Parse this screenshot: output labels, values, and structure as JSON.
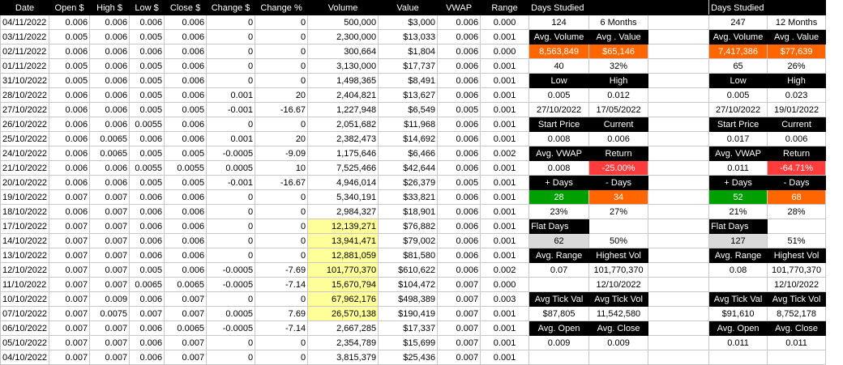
{
  "headers": [
    "Date",
    "Open $",
    "High $",
    "Low $",
    "Close $",
    "Change $",
    "Change %",
    "Volume",
    "Value",
    "VWAP",
    "Range"
  ],
  "rows": [
    [
      "04/11/2022",
      "0.006",
      "0.006",
      "0.006",
      "0.006",
      "0",
      "0",
      "500,000",
      "$3,000",
      "0.006",
      "0.000"
    ],
    [
      "03/11/2022",
      "0.005",
      "0.006",
      "0.005",
      "0.006",
      "0",
      "0",
      "2,300,000",
      "$13,033",
      "0.006",
      "0.001"
    ],
    [
      "02/11/2022",
      "0.006",
      "0.006",
      "0.006",
      "0.006",
      "0",
      "0",
      "300,664",
      "$1,804",
      "0.006",
      "0.000"
    ],
    [
      "01/11/2022",
      "0.005",
      "0.006",
      "0.005",
      "0.006",
      "0",
      "0",
      "3,130,000",
      "$17,737",
      "0.006",
      "0.001"
    ],
    [
      "31/10/2022",
      "0.005",
      "0.006",
      "0.005",
      "0.006",
      "0",
      "0",
      "1,498,365",
      "$8,491",
      "0.006",
      "0.001"
    ],
    [
      "28/10/2022",
      "0.006",
      "0.006",
      "0.005",
      "0.006",
      "0.001",
      "20",
      "2,404,821",
      "$13,627",
      "0.006",
      "0.001"
    ],
    [
      "27/10/2022",
      "0.006",
      "0.006",
      "0.005",
      "0.005",
      "-0.001",
      "-16.67",
      "1,227,948",
      "$6,549",
      "0.005",
      "0.001"
    ],
    [
      "26/10/2022",
      "0.006",
      "0.006",
      "0.0055",
      "0.006",
      "0",
      "0",
      "2,051,682",
      "$11,968",
      "0.006",
      "0.001"
    ],
    [
      "25/10/2022",
      "0.006",
      "0.0065",
      "0.006",
      "0.006",
      "0.001",
      "20",
      "2,382,473",
      "$14,692",
      "0.006",
      "0.001"
    ],
    [
      "24/10/2022",
      "0.006",
      "0.0065",
      "0.005",
      "0.005",
      "-0.0005",
      "-9.09",
      "1,175,646",
      "$6,466",
      "0.006",
      "0.002"
    ],
    [
      "21/10/2022",
      "0.006",
      "0.006",
      "0.0055",
      "0.0055",
      "0.0005",
      "10",
      "7,525,466",
      "$42,644",
      "0.006",
      "0.001"
    ],
    [
      "20/10/2022",
      "0.006",
      "0.006",
      "0.005",
      "0.005",
      "-0.001",
      "-16.67",
      "4,946,014",
      "$26,379",
      "0.005",
      "0.001"
    ],
    [
      "19/10/2022",
      "0.007",
      "0.007",
      "0.006",
      "0.006",
      "0",
      "0",
      "5,340,191",
      "$33,821",
      "0.006",
      "0.001"
    ],
    [
      "18/10/2022",
      "0.006",
      "0.007",
      "0.006",
      "0.006",
      "0",
      "0",
      "2,984,327",
      "$18,901",
      "0.006",
      "0.001"
    ],
    [
      "17/10/2022",
      "0.007",
      "0.007",
      "0.006",
      "0.006",
      "0",
      "0",
      "12,139,271",
      "$76,882",
      "0.006",
      "0.001"
    ],
    [
      "14/10/2022",
      "0.007",
      "0.007",
      "0.006",
      "0.006",
      "0",
      "0",
      "13,941,471",
      "$79,002",
      "0.006",
      "0.001"
    ],
    [
      "13/10/2022",
      "0.007",
      "0.007",
      "0.006",
      "0.006",
      "0",
      "0",
      "12,881,059",
      "$81,580",
      "0.006",
      "0.001"
    ],
    [
      "12/10/2022",
      "0.007",
      "0.007",
      "0.005",
      "0.006",
      "-0.0005",
      "-7.69",
      "101,770,370",
      "$610,622",
      "0.006",
      "0.002"
    ],
    [
      "11/10/2022",
      "0.007",
      "0.007",
      "0.0065",
      "0.0065",
      "-0.0005",
      "-7.14",
      "15,670,794",
      "$104,472",
      "0.007",
      "0.000"
    ],
    [
      "10/10/2022",
      "0.007",
      "0.009",
      "0.006",
      "0.007",
      "0",
      "0",
      "67,962,176",
      "$498,389",
      "0.007",
      "0.003"
    ],
    [
      "07/10/2022",
      "0.007",
      "0.0075",
      "0.007",
      "0.007",
      "0.0005",
      "7.69",
      "26,570,138",
      "$190,419",
      "0.007",
      "0.001"
    ],
    [
      "06/10/2022",
      "0.007",
      "0.007",
      "0.006",
      "0.0065",
      "-0.0005",
      "-7.14",
      "2,667,285",
      "$17,337",
      "0.007",
      "0.001"
    ],
    [
      "05/10/2022",
      "0.007",
      "0.007",
      "0.006",
      "0.007",
      "0",
      "0",
      "2,354,789",
      "$15,699",
      "0.007",
      "0.001"
    ],
    [
      "04/10/2022",
      "0.007",
      "0.007",
      "0.006",
      "0.007",
      "0",
      "0",
      "3,815,379",
      "$25,436",
      "0.007",
      "0.001"
    ]
  ],
  "highlighted_volume_rows": [
    14,
    15,
    16,
    17,
    18,
    19,
    20
  ],
  "colors": {
    "header_bg": "#000000",
    "highlight": "#ffff99",
    "orange": "#ff6600",
    "green": "#00a000",
    "red": "#ff3b3b",
    "grey": "#d9d9d9"
  },
  "panels": [
    {
      "days_label": "Days Studied",
      "days": "124",
      "period": "6 Months",
      "avg_volume_label": "Avg. Volume",
      "avg_value_label": "Avg . Value",
      "avg_volume": "8,563,849",
      "avg_value": "$65,146",
      "count_a": "40",
      "pct_a": "32%",
      "low_label": "Low",
      "high_label": "High",
      "low": "0.005",
      "high": "0.012",
      "low_date": "27/10/2022",
      "high_date": "17/05/2022",
      "start_label": "Start Price",
      "current_label": "Current",
      "start": "0.008",
      "current": "0.006",
      "vwap_label": "Avg. VWAP",
      "return_label": "Return",
      "vwap": "0.008",
      "return": "-25.00%",
      "plus_days_label": "+ Days",
      "minus_days_label": "- Days",
      "plus_days": "28",
      "minus_days": "34",
      "plus_pct": "23%",
      "minus_pct": "27%",
      "flat_label": "Flat Days",
      "flat": "62",
      "flat_pct": "50%",
      "range_label": "Avg. Range",
      "highest_vol_label": "Highest Vol",
      "range": "0.07",
      "highest_vol": "101,770,370",
      "highest_vol_date": "12/10/2022",
      "tick_val_label": "Avg Tick Val",
      "tick_vol_label": "Avg Tick Vol",
      "tick_val": "$87,805",
      "tick_vol": "11,542,580",
      "open_label": "Avg. Open",
      "close_label": "Avg. Close",
      "avg_open": "0.009",
      "avg_close": "0.009"
    },
    {
      "days_label": "Days Studied",
      "days": "247",
      "period": "12 Months",
      "avg_volume_label": "Avg. Volume",
      "avg_value_label": "Avg . Value",
      "avg_volume": "7,417,386",
      "avg_value": "$77,639",
      "count_a": "65",
      "pct_a": "26%",
      "low_label": "Low",
      "high_label": "High",
      "low": "0.005",
      "high": "0.023",
      "low_date": "27/10/2022",
      "high_date": "19/01/2022",
      "start_label": "Start Price",
      "current_label": "Current",
      "start": "0.017",
      "current": "0.006",
      "vwap_label": "Avg. VWAP",
      "return_label": "Return",
      "vwap": "0.011",
      "return": "-64.71%",
      "plus_days_label": "+ Days",
      "minus_days_label": "- Days",
      "plus_days": "52",
      "minus_days": "68",
      "plus_pct": "21%",
      "minus_pct": "28%",
      "flat_label": "Flat Days",
      "flat": "127",
      "flat_pct": "51%",
      "range_label": "Avg. Range",
      "highest_vol_label": "Highest Vol",
      "range": "0.08",
      "highest_vol": "101,770,370",
      "highest_vol_date": "12/10/2022",
      "tick_val_label": "Avg Tick Val",
      "tick_vol_label": "Avg Tick Vol",
      "tick_val": "$91,610",
      "tick_vol": "8,752,178",
      "open_label": "Avg. Open",
      "close_label": "Avg. Close",
      "avg_open": "0.011",
      "avg_close": "0.011"
    }
  ]
}
